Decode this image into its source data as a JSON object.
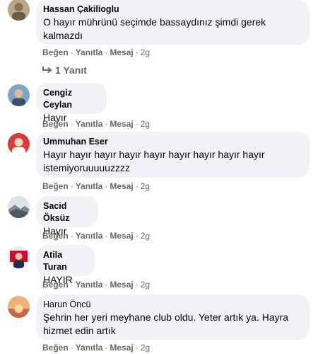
{
  "actions": {
    "like": "Beğen",
    "reply": "Yanıtla",
    "message": "Mesaj",
    "sep": "·"
  },
  "comments": [
    {
      "author": "Hassan Çakilioglu",
      "text": "O hayır mührünü seçimde bassaydınız şimdi gerek kalmazdı",
      "time": "2g"
    },
    {
      "author": "Cengiz Ceylan",
      "text": "Hayır",
      "time": "2g"
    },
    {
      "author": "Ummuhan Eser",
      "text": "Hayır hayır hayır hayır hayır hayır hayır hayır hayır istemiyoruuuuuzzzz",
      "time": "2g"
    },
    {
      "author": "Sacid Öksüz",
      "text": "Hayır",
      "time": "2g"
    },
    {
      "author": "Atila Turan",
      "text": "HAYIR",
      "time": "2g"
    },
    {
      "author": "Harun Öncü",
      "text": "Şehrin her yeri meyhane club oldu. Yeter artık ya. Hayra hizmet edin artık",
      "time": "2g"
    }
  ],
  "replies_link": {
    "label": "1 Yanıt",
    "icon": "reply-arrow-icon"
  }
}
